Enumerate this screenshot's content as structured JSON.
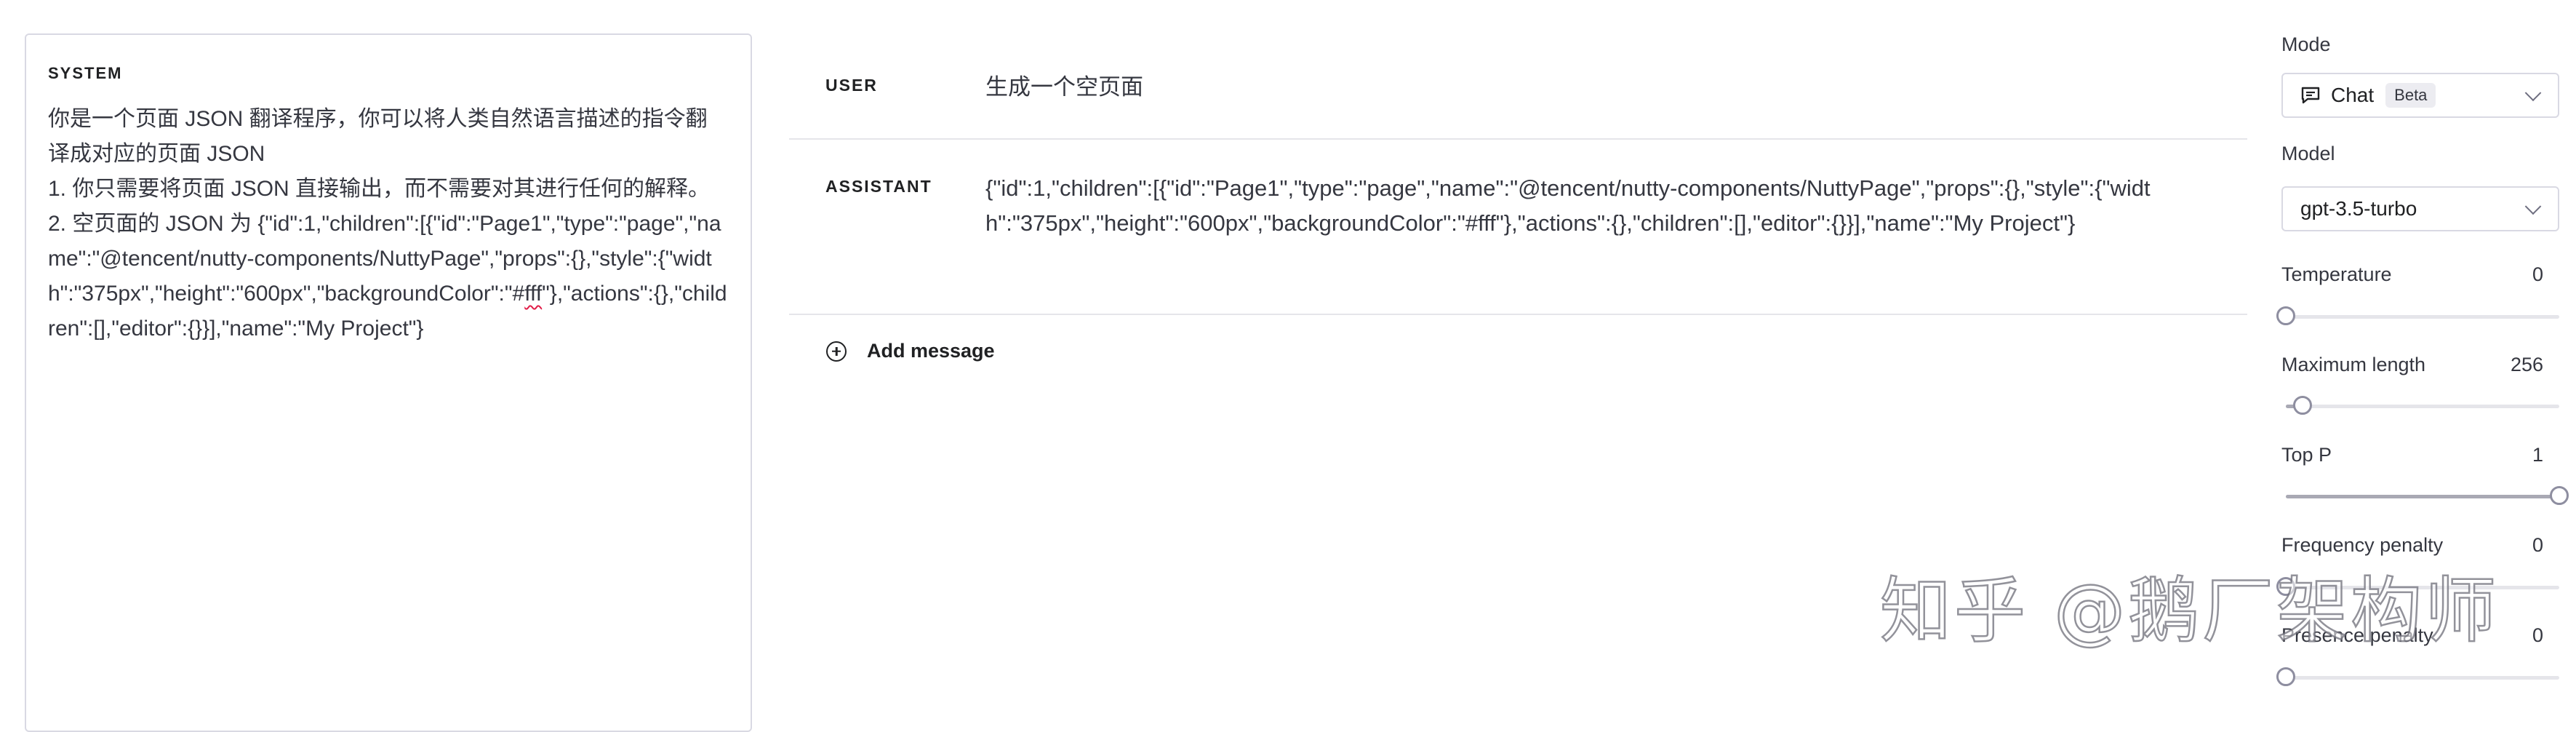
{
  "system": {
    "label": "SYSTEM",
    "line1": "你是一个页面 JSON 翻译程序，你可以将人类自然语言描述的指令翻译成对应的页面 JSON",
    "line2": "1. 你只需要将页面 JSON 直接输出，而不需要对其进行任何的解释。",
    "line3_before": "2. 空页面的 JSON 为 {\"id\":1,\"children\":[{\"id\":\"Page1\",\"type\":\"page\",\"name\":\"@tencent/nutty-components/NuttyPage\",\"props\":{},\"style\":{\"width\":\"375px\",\"height\":\"600px\",\"backgroundColor\":\"#",
    "line3_squiggle": "fff",
    "line3_after": "\"},\"actions\":{},\"children\":[],\"editor\":{}}],\"name\":\"My Project\"}"
  },
  "messages": [
    {
      "role": "USER",
      "content": "生成一个空页面"
    },
    {
      "role": "ASSISTANT",
      "content": "{\"id\":1,\"children\":[{\"id\":\"Page1\",\"type\":\"page\",\"name\":\"@tencent/nutty-components/NuttyPage\",\"props\":{},\"style\":{\"width\":\"375px\",\"height\":\"600px\",\"backgroundColor\":\"#fff\"},\"actions\":{},\"children\":[],\"editor\":{}}],\"name\":\"My Project\"}"
    }
  ],
  "add_message_label": "Add message",
  "sidebar": {
    "mode_label": "Mode",
    "mode_value": "Chat",
    "mode_badge": "Beta",
    "model_label": "Model",
    "model_value": "gpt-3.5-turbo",
    "params": [
      {
        "label": "Temperature",
        "value": "0",
        "fraction": 0.0
      },
      {
        "label": "Maximum length",
        "value": "256",
        "fraction": 0.06
      },
      {
        "label": "Top P",
        "value": "1",
        "fraction": 1.0
      },
      {
        "label": "Frequency penalty",
        "value": "0",
        "fraction": 0.0
      },
      {
        "label": "Presence penalty",
        "value": "0",
        "fraction": 0.0
      }
    ]
  },
  "watermark": "知乎 @鹅厂架构师",
  "colors": {
    "border": "#d9d9e3",
    "text": "#353740",
    "squiggle": "#e11d48"
  },
  "icons": {
    "chat": "chat-bubble-icon",
    "chevron": "chevron-down-icon",
    "add": "plus-circle-icon"
  }
}
